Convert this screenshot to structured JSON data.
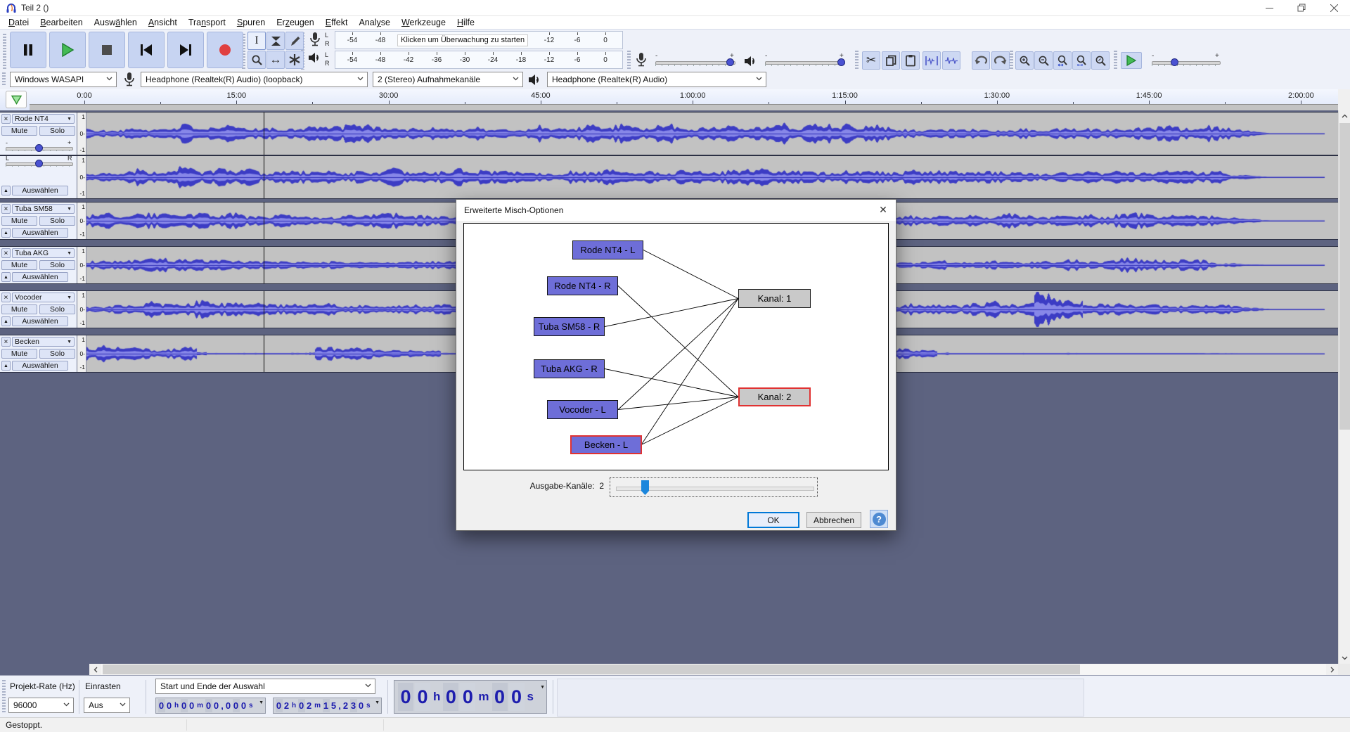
{
  "window": {
    "title": "Teil 2 ()"
  },
  "menu": {
    "items": [
      {
        "label": "Datei",
        "key": "D"
      },
      {
        "label": "Bearbeiten",
        "key": "B"
      },
      {
        "label": "Auswählen",
        "key": "ä"
      },
      {
        "label": "Ansicht",
        "key": "A"
      },
      {
        "label": "Transport",
        "key": "n"
      },
      {
        "label": "Spuren",
        "key": "S"
      },
      {
        "label": "Erzeugen",
        "key": "z"
      },
      {
        "label": "Effekt",
        "key": "E"
      },
      {
        "label": "Analyse",
        "key": "y"
      },
      {
        "label": "Werkzeuge",
        "key": "W"
      },
      {
        "label": "Hilfe",
        "key": "H"
      }
    ]
  },
  "toolbar_icons": {
    "transport": [
      "pause",
      "play",
      "stop",
      "skip-to-start",
      "skip-to-end",
      "record"
    ],
    "tools": [
      "selection-tool",
      "envelope-tool",
      "draw-tool",
      "zoom-tool",
      "timeshift-tool",
      "multi-tool"
    ],
    "edit": [
      "cut",
      "copy",
      "paste",
      "trim-audio",
      "silence-audio"
    ],
    "history": [
      "undo",
      "redo"
    ],
    "zoom": [
      "zoom-in",
      "zoom-out",
      "zoom-to-selection",
      "zoom-to-fit",
      "zoom-toggle"
    ]
  },
  "meters": {
    "record": {
      "channels": [
        "L",
        "R"
      ],
      "ticks_left": [
        "-54",
        "-48"
      ],
      "ticks_right": [
        "-12",
        "-6",
        "0"
      ],
      "overlay": "Klicken um Überwachung zu starten"
    },
    "play": {
      "channels": [
        "L",
        "R"
      ],
      "ticks": [
        "-54",
        "-48",
        "-42",
        "-36",
        "-30",
        "-24",
        "-18",
        "-12",
        "-6",
        "0"
      ]
    }
  },
  "mixer": {
    "min": "-",
    "max": "+"
  },
  "device": {
    "host": "Windows WASAPI",
    "recording": "Headphone (Realtek(R) Audio) (loopback)",
    "channels": "2 (Stereo) Aufnahmekanäle",
    "playback": "Headphone (Realtek(R) Audio)"
  },
  "timeline": {
    "labels": [
      "0:00",
      "15:00",
      "30:00",
      "45:00",
      "1:00:00",
      "1:15:00",
      "1:30:00",
      "1:45:00",
      "2:00:00"
    ]
  },
  "track_ui": {
    "close": "×",
    "dropdown": "▼",
    "mute": "Mute",
    "solo": "Solo",
    "collapse": "▲",
    "select": "Auswählen",
    "gain_min": "-",
    "gain_max": "+",
    "pan_left": "L",
    "pan_right": "R",
    "scale": [
      "1",
      "0",
      "-1"
    ]
  },
  "tracks": [
    {
      "name": "Rode NT4",
      "stereo": true
    },
    {
      "name": "Tuba SM58",
      "stereo": false
    },
    {
      "name": "Tuba AKG",
      "stereo": false
    },
    {
      "name": "Vocoder",
      "stereo": false
    },
    {
      "name": "Becken",
      "stereo": false
    }
  ],
  "dialog": {
    "title": "Erweiterte Misch-Optionen",
    "close": "✕",
    "sources": [
      {
        "label": "Rode NT4 - L",
        "selected": false
      },
      {
        "label": "Rode NT4 - R",
        "selected": false
      },
      {
        "label": "Tuba SM58 - R",
        "selected": false
      },
      {
        "label": "Tuba AKG - R",
        "selected": false
      },
      {
        "label": "Vocoder - L",
        "selected": false
      },
      {
        "label": "Becken - L",
        "selected": true
      }
    ],
    "channels": [
      {
        "label": "Kanal:  1",
        "selected": false
      },
      {
        "label": "Kanal:  2",
        "selected": true
      }
    ],
    "connections": [
      [
        0,
        0
      ],
      [
        1,
        1
      ],
      [
        2,
        0
      ],
      [
        3,
        1
      ],
      [
        4,
        0
      ],
      [
        4,
        1
      ],
      [
        5,
        0
      ],
      [
        5,
        1
      ]
    ],
    "output_label": "Ausgabe-Kanäle:",
    "output_value": "2",
    "ok": "OK",
    "cancel": "Abbrechen",
    "help": "?"
  },
  "selection": {
    "rate_label": "Projekt-Rate (Hz)",
    "rate_value": "96000",
    "snap_label": "Einrasten",
    "snap_value": "Aus",
    "mode": "Start und Ende der Auswahl",
    "start_parts": [
      "00",
      "h",
      "00",
      "m",
      "00,000",
      "s"
    ],
    "end_parts": [
      "02",
      "h",
      "02",
      "m",
      "15,230",
      "s"
    ],
    "counter_parts": [
      "00",
      "h",
      "00",
      "m",
      "00",
      "s"
    ]
  },
  "status": {
    "text": "Gestoppt."
  }
}
